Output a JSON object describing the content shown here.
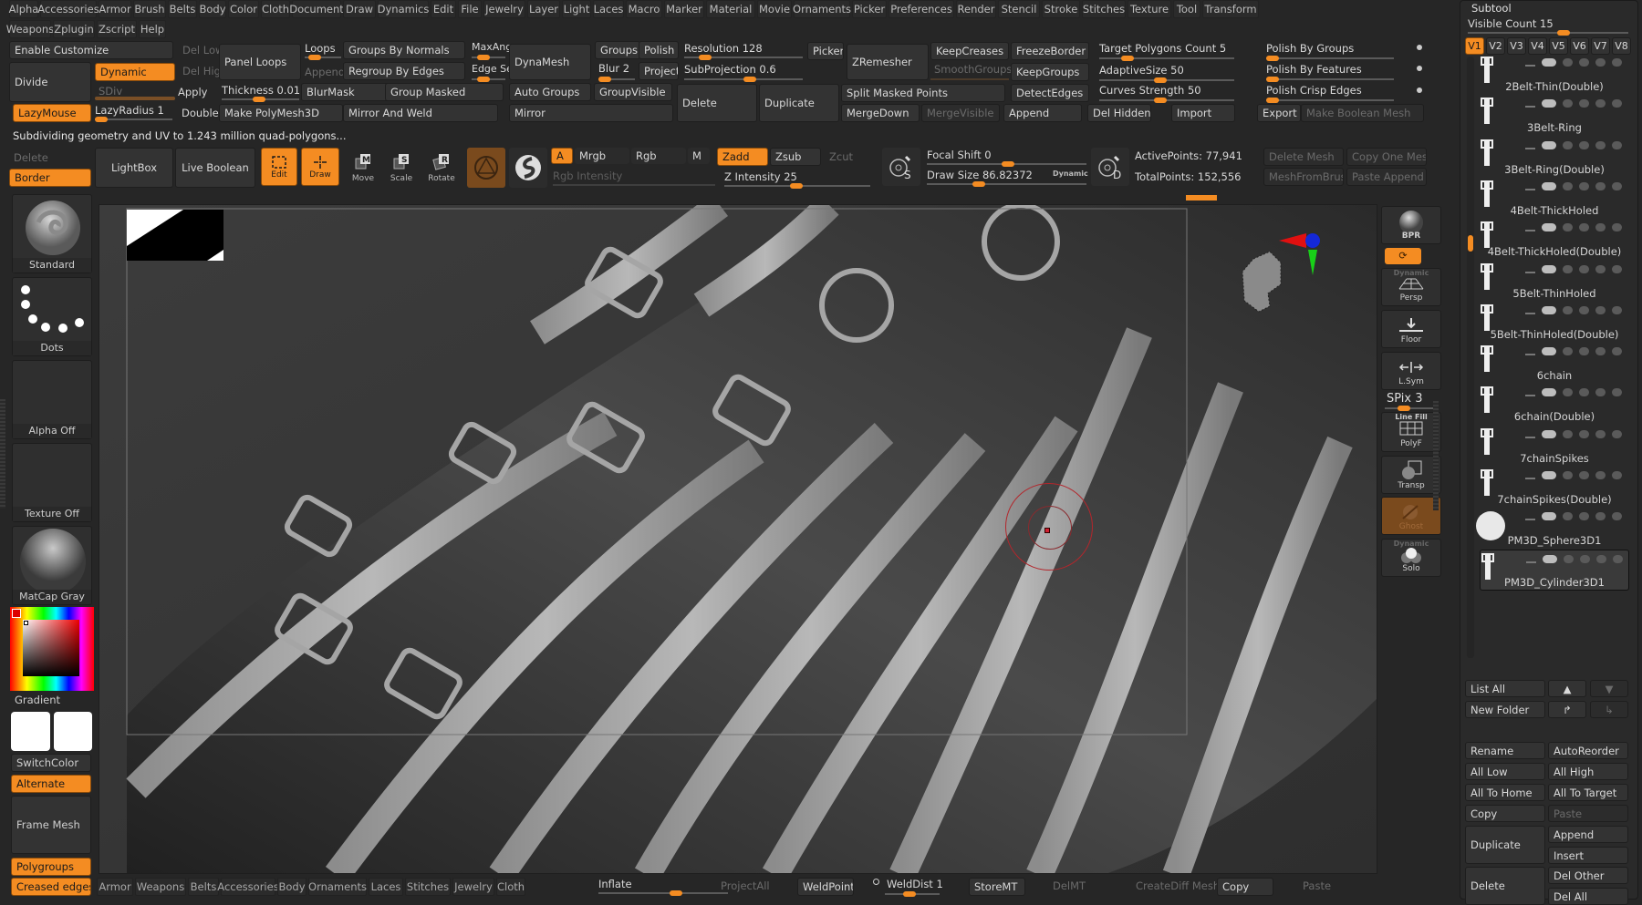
{
  "menubar": {
    "row1": [
      "Alpha",
      "Accessories",
      "Armor",
      "Brush",
      "Belts",
      "Body",
      "Color",
      "Cloth",
      "Document",
      "Draw",
      "Dynamics",
      "Edit",
      "File",
      "Jewelry",
      "Layer",
      "Light",
      "Laces",
      "Macro",
      "Marker",
      "Material",
      "Movie",
      "Ornaments",
      "Picker",
      "Preferences",
      "Render",
      "Stencil",
      "Stroke",
      "Stitches",
      "Texture",
      "Tool",
      "Transform"
    ],
    "row2": [
      "Weapons",
      "Zplugin",
      "Zscript",
      "Help"
    ]
  },
  "geometry": {
    "enable_customize": "Enable Customize",
    "divide": "Divide",
    "dynamic": "Dynamic",
    "sdiv": "SDiv",
    "del_lower": "Del Lower",
    "del_higher": "Del Higher",
    "lazymouse": "LazyMouse",
    "lazyradius": "LazyRadius 1",
    "panel_loops": "Panel Loops",
    "loops": "Loops",
    "append": "Append",
    "apply": "Apply",
    "thickness": "Thickness 0.01",
    "double": "Double",
    "make_polymesh": "Make PolyMesh3D",
    "groups_by_normals": "Groups By Normals",
    "regroup_by_edges": "Regroup By Edges",
    "blurmask": "BlurMask",
    "group_masked": "Group Masked",
    "mirror_and_weld": "Mirror And Weld",
    "maxangle": "MaxAng",
    "edge_se": "Edge Se",
    "dynamesh": "DynaMesh",
    "auto_groups": "Auto Groups",
    "mirror": "Mirror",
    "groups": "Groups",
    "polish": "Polish",
    "blur": "Blur 2",
    "project": "Project",
    "groupvisible": "GroupVisible",
    "resolution": "Resolution 128",
    "subprojection": "SubProjection 0.6",
    "delete": "Delete",
    "duplicate": "Duplicate",
    "picker": "Picker",
    "zremesher": "ZRemesher",
    "keepcreases": "KeepCreases",
    "smoothgroups": "SmoothGroups",
    "split_masked": "Split Masked Points",
    "mergedown": "MergeDown",
    "mergevisible": "MergeVisible",
    "freezeborder": "FreezeBorder",
    "keepgroups": "KeepGroups",
    "detectedges": "DetectEdges",
    "append2": "Append",
    "target_polygons": "Target Polygons Count 5",
    "adaptivesize": "AdaptiveSize 50",
    "curves_strength": "Curves Strength 50",
    "del_hidden": "Del Hidden",
    "import": "Import",
    "polish_by_groups": "Polish By Groups",
    "polish_by_features": "Polish By Features",
    "polish_crisp_edges": "Polish Crisp Edges",
    "export": "Export",
    "make_boolean": "Make Boolean Mesh"
  },
  "status_message": "Subdividing geometry and UV to 1.243 million quad-polygons...",
  "toolbar": {
    "delete": "Delete",
    "border": "Border",
    "lightbox": "LightBox",
    "live_boolean": "Live Boolean",
    "edit": "Edit",
    "draw": "Draw",
    "move": "Move",
    "scale": "Scale",
    "rotate": "Rotate",
    "a": "A",
    "mrgb": "Mrgb",
    "rgb": "Rgb",
    "m": "M",
    "rgb_intensity": "Rgb Intensity",
    "zadd": "Zadd",
    "zsub": "Zsub",
    "zcut": "Zcut",
    "z_intensity": "Z Intensity 25",
    "focal_shift": "Focal Shift 0",
    "draw_size": "Draw Size 86.82372",
    "dynamic": "Dynamic",
    "active_points": "ActivePoints: 77,941",
    "total_points": "TotalPoints: 152,556",
    "delete_mesh": "Delete Mesh",
    "copy_one_mesh": "Copy One Mesh",
    "mesh_from_brush": "MeshFromBrush",
    "paste_append": "Paste Append"
  },
  "left_shelf": {
    "brush": "Standard",
    "stroke": "Dots",
    "alpha": "Alpha Off",
    "texture": "Texture Off",
    "material": "MatCap Gray",
    "gradient": "Gradient",
    "switchcolor": "SwitchColor",
    "alternate": "Alternate",
    "frame_mesh": "Frame Mesh",
    "polygroups": "Polygroups",
    "creased_edges": "Creased edges"
  },
  "right_shelf": {
    "bpr": "BPR",
    "dynamic": "Dynamic",
    "persp": "Persp",
    "floor": "Floor",
    "lsym": "L.Sym",
    "spix": "SPix 3",
    "line_fill": "Line Fill",
    "polyf": "PolyF",
    "transp": "Transp",
    "ghost": "Ghost",
    "dynamic2": "Dynamic",
    "solo": "Solo"
  },
  "subtool": {
    "title": "Subtool",
    "visible_count": "Visible Count 15",
    "visible_count_value": 15,
    "tabs": [
      "V1",
      "V2",
      "V3",
      "V4",
      "V5",
      "V6",
      "V7",
      "V8"
    ],
    "items": [
      {
        "name": "2Belt-Thin(Double)"
      },
      {
        "name": "3Belt-Ring"
      },
      {
        "name": "3Belt-Ring(Double)"
      },
      {
        "name": "4Belt-ThickHoled"
      },
      {
        "name": "4Belt-ThickHoled(Double)"
      },
      {
        "name": "5Belt-ThinHoled"
      },
      {
        "name": "5Belt-ThinHoled(Double)"
      },
      {
        "name": "6chain"
      },
      {
        "name": "6chain(Double)"
      },
      {
        "name": "7chainSpikes"
      },
      {
        "name": "7chainSpikes(Double)"
      },
      {
        "name": "PM3D_Sphere3D1"
      },
      {
        "name": "PM3D_Cylinder3D1"
      }
    ],
    "list_all": "List All",
    "new_folder": "New Folder",
    "rename": "Rename",
    "autoreorder": "AutoReorder",
    "all_low": "All Low",
    "all_high": "All High",
    "all_to_home": "All To Home",
    "all_to_target": "All To Target",
    "copy": "Copy",
    "paste": "Paste",
    "duplicate": "Duplicate",
    "append": "Append",
    "insert": "Insert",
    "delete": "Delete",
    "del_other": "Del Other",
    "del_all": "Del All"
  },
  "bottom_bar": {
    "tabs": [
      "Armor",
      "Weapons",
      "Belts",
      "Accessories",
      "Body",
      "Ornaments",
      "Laces",
      "Stitches",
      "Jewelry",
      "Cloth"
    ],
    "inflate": "Inflate",
    "projectall": "ProjectAll",
    "weldpoints": "WeldPoints",
    "welddist": "WeldDist 1",
    "storemt": "StoreMT",
    "delmt": "DelMT",
    "creatediff": "CreateDiff Mesh",
    "copy": "Copy",
    "paste": "Paste"
  },
  "colors": {
    "accent": "#f48c22",
    "background": "#262626",
    "button": "#333333"
  }
}
